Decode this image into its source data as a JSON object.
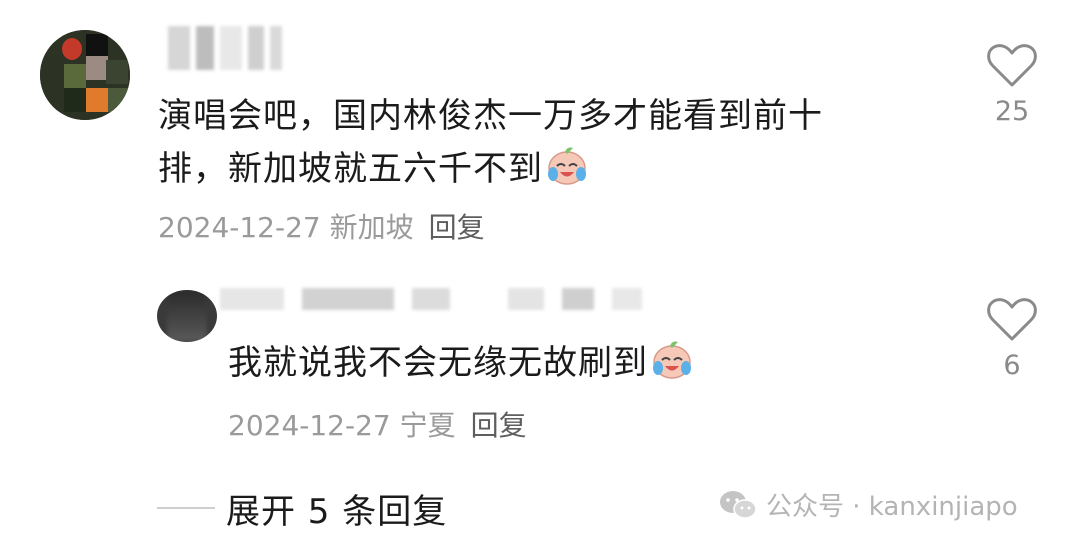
{
  "comments": [
    {
      "text_line1": "演唱会吧，国内林俊杰一万多才能看到前十",
      "text_line2": "排，新加坡就五六千不到",
      "meta_date": "2024-12-27",
      "meta_location": "新加坡",
      "reply_label": "回复",
      "likes": "25"
    },
    {
      "text": "我就说我不会无缘无故刷到",
      "meta_date": "2024-12-27",
      "meta_location": "宁夏",
      "reply_label": "回复",
      "likes": "6"
    }
  ],
  "expand_label": "展开 5 条回复",
  "watermark": "公众号 · kanxinjiapo",
  "emoji": "crying-laughing-face",
  "colors": {
    "text": "#1b1b1b",
    "meta": "#9a9a9a",
    "reply": "#5e5e5e",
    "heart": "#8a8a8a"
  }
}
